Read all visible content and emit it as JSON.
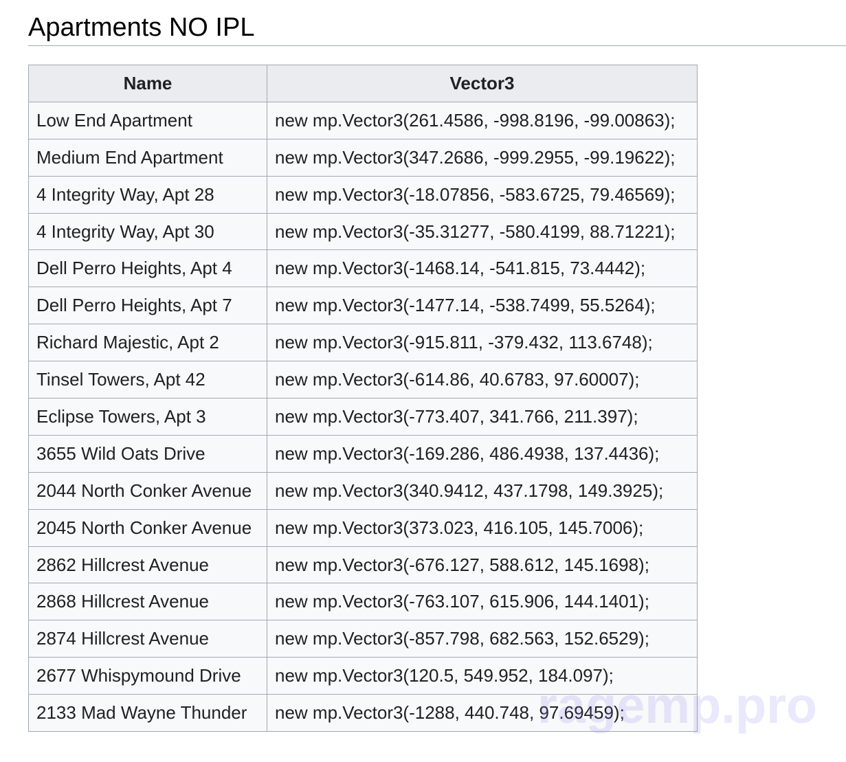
{
  "section": {
    "title": "Apartments NO IPL"
  },
  "table": {
    "headers": [
      "Name",
      "Vector3"
    ],
    "rows": [
      {
        "name": "Low End Apartment",
        "vector": "new mp.Vector3(261.4586, -998.8196, -99.00863);"
      },
      {
        "name": "Medium End Apartment",
        "vector": "new mp.Vector3(347.2686, -999.2955, -99.19622);"
      },
      {
        "name": "4 Integrity Way, Apt 28",
        "vector": "new mp.Vector3(-18.07856, -583.6725, 79.46569);"
      },
      {
        "name": "4 Integrity Way, Apt 30",
        "vector": "new mp.Vector3(-35.31277, -580.4199, 88.71221);"
      },
      {
        "name": "Dell Perro Heights, Apt 4",
        "vector": "new mp.Vector3(-1468.14, -541.815, 73.4442);"
      },
      {
        "name": "Dell Perro Heights, Apt 7",
        "vector": "new mp.Vector3(-1477.14, -538.7499, 55.5264);"
      },
      {
        "name": "Richard Majestic, Apt 2",
        "vector": "new mp.Vector3(-915.811, -379.432, 113.6748);"
      },
      {
        "name": "Tinsel Towers, Apt 42",
        "vector": "new mp.Vector3(-614.86, 40.6783, 97.60007);"
      },
      {
        "name": "Eclipse Towers, Apt 3",
        "vector": "new mp.Vector3(-773.407, 341.766, 211.397);"
      },
      {
        "name": "3655 Wild Oats Drive",
        "vector": "new mp.Vector3(-169.286, 486.4938, 137.4436);"
      },
      {
        "name": "2044 North Conker Avenue",
        "vector": "new mp.Vector3(340.9412, 437.1798, 149.3925);"
      },
      {
        "name": "2045 North Conker Avenue",
        "vector": "new mp.Vector3(373.023, 416.105, 145.7006);"
      },
      {
        "name": "2862 Hillcrest Avenue",
        "vector": "new mp.Vector3(-676.127, 588.612, 145.1698);"
      },
      {
        "name": "2868 Hillcrest Avenue",
        "vector": "new mp.Vector3(-763.107, 615.906, 144.1401);"
      },
      {
        "name": "2874 Hillcrest Avenue",
        "vector": "new mp.Vector3(-857.798, 682.563, 152.6529);"
      },
      {
        "name": "2677 Whispymound Drive",
        "vector": "new mp.Vector3(120.5, 549.952, 184.097);"
      },
      {
        "name": "2133 Mad Wayne Thunder",
        "vector": "new mp.Vector3(-1288, 440.748, 97.69459);"
      }
    ]
  },
  "watermark": {
    "text": "ragemp.pro"
  }
}
